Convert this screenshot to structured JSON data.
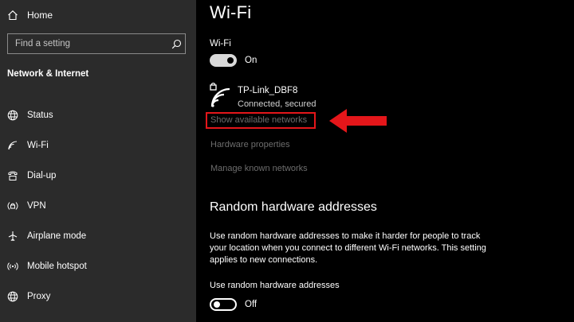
{
  "sidebar": {
    "home_label": "Home",
    "search_placeholder": "Find a setting",
    "section_title": "Network & Internet",
    "items": [
      {
        "label": "Status",
        "icon": "globe-icon"
      },
      {
        "label": "Wi-Fi",
        "icon": "wifi-icon"
      },
      {
        "label": "Dial-up",
        "icon": "dialup-icon"
      },
      {
        "label": "VPN",
        "icon": "vpn-icon"
      },
      {
        "label": "Airplane mode",
        "icon": "airplane-icon"
      },
      {
        "label": "Mobile hotspot",
        "icon": "hotspot-icon"
      },
      {
        "label": "Proxy",
        "icon": "globe-icon"
      }
    ]
  },
  "main": {
    "title": "Wi-Fi",
    "wifi_label": "Wi-Fi",
    "wifi_toggle_state": "On",
    "network": {
      "name": "TP-Link_DBF8",
      "status": "Connected, secured"
    },
    "show_networks": "Show available networks",
    "hardware_properties": "Hardware properties",
    "manage_known": "Manage known networks",
    "random_title": "Random hardware addresses",
    "random_desc": "Use random hardware addresses to make it harder for people to track your location when you connect to different Wi-Fi networks. This setting applies to new connections.",
    "random_label": "Use random hardware addresses",
    "random_toggle_state": "Off"
  },
  "colors": {
    "sidebar_bg": "#2b2b2b",
    "main_bg": "#000000",
    "highlight": "#e4161a",
    "disabled_text": "#6d6d6d"
  }
}
